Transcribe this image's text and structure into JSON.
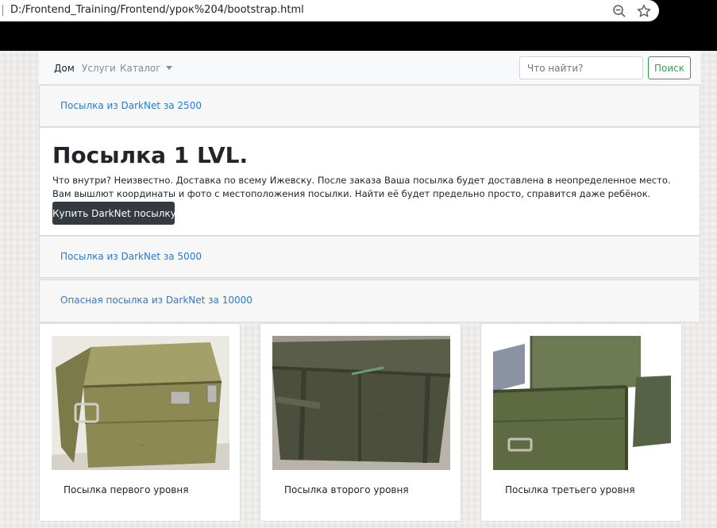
{
  "browser": {
    "url": "D:/Frontend_Training/Frontend/урок%204/bootstrap.html",
    "zoom_icon": "zoom-out-icon",
    "bookmark_icon": "star-icon"
  },
  "navbar": {
    "items": [
      {
        "label": "Дом",
        "active": true
      },
      {
        "label": "Услуги",
        "active": false
      },
      {
        "label": "Каталог",
        "active": false
      }
    ],
    "search": {
      "placeholder": "Что найти?",
      "value": "",
      "button": "Поиск"
    }
  },
  "accordion": {
    "panel1": {
      "link": "Посылка из DarkNet за 2500"
    },
    "open": {
      "title": "Посылка 1 LVL.",
      "text": "Что внутри? Неизвестно. Доставка по всему Ижевску. После заказа Ваша посылка будет доставлена в неопределенное место. Вам вышлют координаты и фото с местоположения посылки. Найти её будет предельно просто, справится даже ребёнок.",
      "button": "Купить DarkNet посылку"
    },
    "panel2": {
      "link": "Посылка из DarkNet за 5000"
    },
    "panel3": {
      "link": "Опасная посылка из DarkNet за 10000"
    }
  },
  "cards": [
    {
      "title": "Посылка первого уровня"
    },
    {
      "title": "Посылка второго уровня"
    },
    {
      "title": "Посылка третьего уровня"
    }
  ],
  "colors": {
    "link": "#2a7ad0",
    "success": "#28a745",
    "dark_button": "#343a40",
    "crate_olive": "#8c8a52",
    "crate_dark": "#4b4f3c",
    "crate_green": "#5e6b42"
  }
}
